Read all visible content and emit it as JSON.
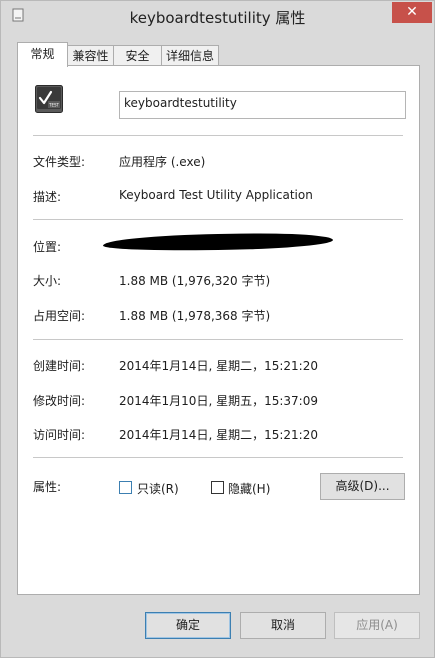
{
  "window": {
    "title": "keyboardtestutility 属性",
    "close_glyph": "✕"
  },
  "tabs": [
    {
      "label": "常规",
      "active": true
    },
    {
      "label": "兼容性",
      "active": false
    },
    {
      "label": "安全",
      "active": false
    },
    {
      "label": "详细信息",
      "active": false
    }
  ],
  "general": {
    "file_name": "keyboardtestutility",
    "icon": "application-icon",
    "rows": {
      "type_label": "文件类型:",
      "type_value": "应用程序 (.exe)",
      "desc_label": "描述:",
      "desc_value": "Keyboard Test Utility Application",
      "location_label": "位置:",
      "size_label": "大小:",
      "size_value": "1.88 MB (1,976,320 字节)",
      "disk_label": "占用空间:",
      "disk_value": "1.88 MB (1,978,368 字节)",
      "created_label": "创建时间:",
      "created_value": "2014年1月14日, 星期二，15:21:20",
      "modified_label": "修改时间:",
      "modified_value": "2014年1月10日, 星期五，15:37:09",
      "accessed_label": "访问时间:",
      "accessed_value": "2014年1月14日, 星期二，15:21:20",
      "attr_label": "属性:"
    },
    "attributes": {
      "readonly_label": "只读(R)",
      "readonly_checked": false,
      "hidden_label": "隐藏(H)",
      "hidden_checked": false,
      "advanced_label": "高级(D)..."
    }
  },
  "footer": {
    "ok_label": "确定",
    "cancel_label": "取消",
    "apply_label": "应用(A)"
  },
  "colors": {
    "accent": "#3c7fb1",
    "close": "#c7514a"
  }
}
